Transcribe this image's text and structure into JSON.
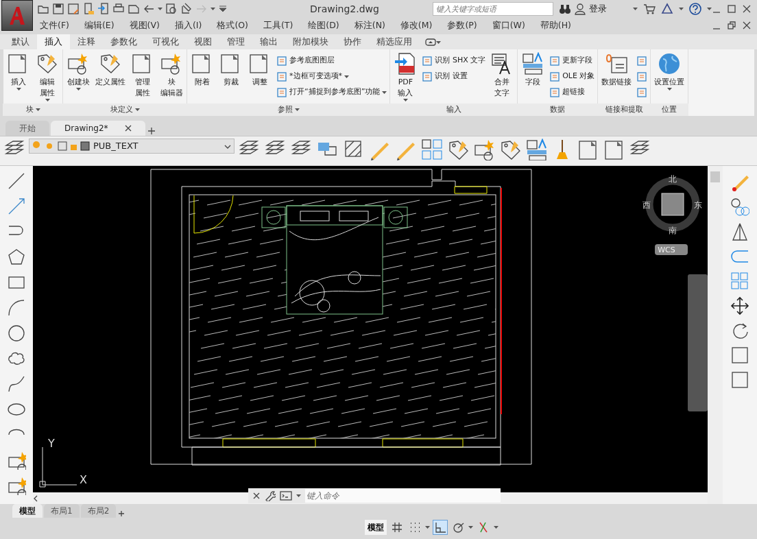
{
  "window": {
    "title": "Drawing2.dwg"
  },
  "search": {
    "placeholder": "键入关键字或短语"
  },
  "login": "登录",
  "menu": [
    "文件(F)",
    "编辑(E)",
    "视图(V)",
    "插入(I)",
    "格式(O)",
    "工具(T)",
    "绘图(D)",
    "标注(N)",
    "修改(M)",
    "参数(P)",
    "窗口(W)",
    "帮助(H)"
  ],
  "ribbon_tabs": [
    {
      "label": "默认",
      "selected": false
    },
    {
      "label": "插入",
      "selected": true
    },
    {
      "label": "注释",
      "selected": false
    },
    {
      "label": "参数化",
      "selected": false
    },
    {
      "label": "可视化",
      "selected": false
    },
    {
      "label": "视图",
      "selected": false
    },
    {
      "label": "管理",
      "selected": false
    },
    {
      "label": "输出",
      "selected": false
    },
    {
      "label": "附加模块",
      "selected": false
    },
    {
      "label": "协作",
      "selected": false
    },
    {
      "label": "精选应用",
      "selected": false
    }
  ],
  "ribbon_panels": [
    {
      "title": "块",
      "title_dropdown": true,
      "items": [
        {
          "kind": "large",
          "lines": [
            "插入"
          ],
          "dropdown": true
        },
        {
          "kind": "large",
          "lines": [
            "编辑",
            "属性"
          ],
          "dropdown": true
        }
      ]
    },
    {
      "title": "块定义",
      "title_dropdown": true,
      "items": [
        {
          "kind": "large",
          "lines": [
            "创建块"
          ],
          "dropdown": true
        },
        {
          "kind": "large",
          "lines": [
            "定义属性"
          ],
          "dropdown": false
        },
        {
          "kind": "large",
          "lines": [
            "管理",
            "属性"
          ],
          "dropdown": false
        },
        {
          "kind": "large",
          "lines": [
            "块",
            "编辑器"
          ],
          "dropdown": false
        }
      ]
    },
    {
      "title": "参照",
      "title_dropdown": true,
      "items": [
        {
          "kind": "large",
          "lines": [
            "附着"
          ],
          "dropdown": false
        },
        {
          "kind": "large",
          "lines": [
            "剪裁"
          ],
          "dropdown": false
        },
        {
          "kind": "large",
          "lines": [
            "调整"
          ],
          "dropdown": false
        },
        {
          "kind": "stack",
          "items": [
            {
              "label": "参考底图图层",
              "dropdown": false
            },
            {
              "label": "*边框可变选项*",
              "dropdown": true
            },
            {
              "label": "打开“捕捉到参考底图”功能",
              "dropdown": true
            }
          ]
        }
      ]
    },
    {
      "title": "输入",
      "title_dropdown": false,
      "items": [
        {
          "kind": "large",
          "lines": [
            "PDF",
            "输入"
          ],
          "dropdown": true
        },
        {
          "kind": "stack",
          "items": [
            {
              "label": "识别 SHX 文字",
              "dropdown": false
            },
            {
              "label": "识别 设置",
              "dropdown": false
            }
          ]
        },
        {
          "kind": "large",
          "lines": [
            "合并",
            "文字"
          ],
          "dropdown": false
        }
      ]
    },
    {
      "title": "数据",
      "title_dropdown": false,
      "items": [
        {
          "kind": "large",
          "lines": [
            "字段"
          ],
          "dropdown": false
        },
        {
          "kind": "stack",
          "items": [
            {
              "label": "更新字段",
              "dropdown": false
            },
            {
              "label": "OLE 对象",
              "dropdown": false
            },
            {
              "label": "超链接",
              "dropdown": false
            }
          ]
        }
      ]
    },
    {
      "title": "链接和提取",
      "title_dropdown": false,
      "items": [
        {
          "kind": "large",
          "lines": [
            "数据链接"
          ],
          "dropdown": false
        },
        {
          "kind": "stack",
          "items": [
            {
              "dropdown": false
            },
            {
              "dropdown": false
            },
            {
              "dropdown": false
            }
          ]
        }
      ]
    },
    {
      "title": "位置",
      "title_dropdown": false,
      "items": [
        {
          "kind": "large",
          "lines": [
            "设置位置"
          ],
          "dropdown": true
        }
      ]
    }
  ],
  "file_tabs": [
    {
      "label": "开始",
      "selected": false
    },
    {
      "label": "Drawing2*",
      "selected": true
    }
  ],
  "layer": {
    "name": "PUB_TEXT"
  },
  "viewcube": {
    "north": "北",
    "south": "南",
    "west": "西",
    "east": "东",
    "wcs": "WCS"
  },
  "ucs": {
    "x": "X",
    "y": "Y"
  },
  "command": {
    "placeholder": "键入命令"
  },
  "layout_tabs": [
    {
      "label": "模型",
      "selected": true
    },
    {
      "label": "布局1",
      "selected": false
    },
    {
      "label": "布局2",
      "selected": false
    }
  ],
  "status_bar": {
    "model": "模型",
    "toggles": [
      {
        "on": false
      },
      {
        "on": false
      },
      {
        "on": true
      },
      {
        "on": false
      },
      {
        "on": false
      }
    ]
  }
}
